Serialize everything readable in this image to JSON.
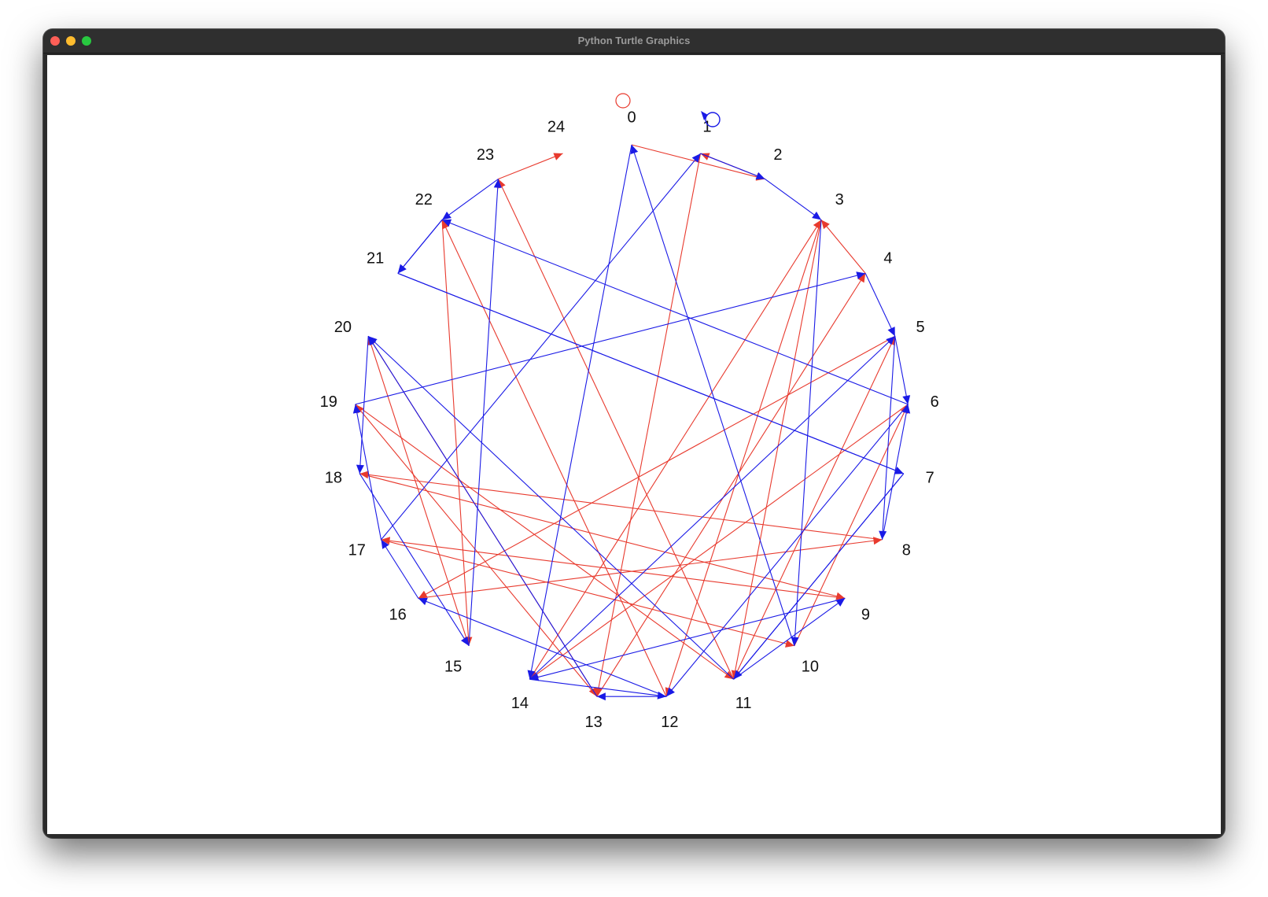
{
  "window": {
    "title": "Python Turtle Graphics",
    "buttons": {
      "close": "close",
      "minimize": "minimize",
      "zoom": "zoom"
    }
  },
  "diagram": {
    "node_labels": [
      "0",
      "1",
      "2",
      "3",
      "4",
      "5",
      "6",
      "7",
      "8",
      "9",
      "10",
      "11",
      "12",
      "13",
      "14",
      "15",
      "16",
      "17",
      "18",
      "19",
      "20",
      "21",
      "22",
      "23",
      "24"
    ],
    "colors": {
      "red": "#e83a2e",
      "blue": "#1a1ae6"
    },
    "red_path": [
      0,
      2,
      1,
      13,
      4,
      3,
      11,
      5,
      16,
      8,
      18,
      9,
      17,
      10,
      6,
      14,
      3,
      12,
      22,
      15,
      20,
      13,
      19,
      11,
      23,
      24
    ],
    "blue_path": [
      17,
      1,
      2,
      3,
      10,
      0,
      14,
      5,
      8,
      6,
      22,
      21,
      7,
      11,
      9,
      14,
      12,
      16,
      17,
      19,
      4,
      5,
      6,
      12,
      13,
      20,
      18,
      15,
      23,
      22,
      21,
      7,
      11,
      20
    ],
    "turtles": [
      {
        "name": "red-turtle",
        "color": "#e83a2e"
      },
      {
        "name": "blue-turtle",
        "color": "#1a1ae6"
      }
    ]
  }
}
